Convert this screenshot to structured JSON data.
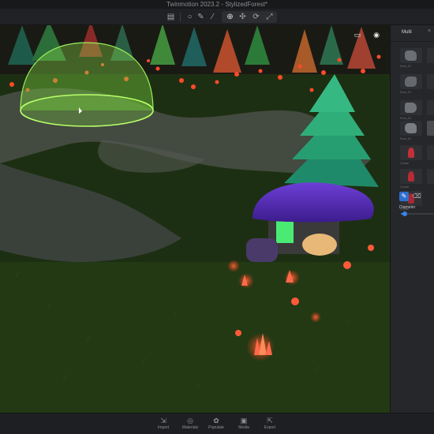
{
  "window": {
    "title": "Twinmotion 2023.2 - StylizedForest*"
  },
  "toolbar": {
    "icons": [
      "layers-icon",
      "circle-select-icon",
      "paint-brush-icon",
      "eyedropper-icon",
      "crosshair-move-icon",
      "move-arrows-icon",
      "rotate-icon",
      "scale-icon"
    ]
  },
  "viewport": {
    "controls": [
      "screen-icon",
      "eye-icon"
    ]
  },
  "panel": {
    "title": "Multi",
    "close_glyph": "×",
    "thumbnails": [
      {
        "caption": "Rock_01",
        "kind": "rock"
      },
      {
        "caption": "Rock_02",
        "kind": "rock"
      },
      {
        "caption": "Rock_03",
        "kind": "rock"
      },
      {
        "caption": "Rock_04",
        "kind": "rock"
      },
      {
        "caption": "Crystal",
        "kind": "crystal"
      },
      {
        "caption": "Crystal",
        "kind": "crystal"
      },
      {
        "caption": "Crystal",
        "kind": "crystal"
      }
    ],
    "tools": [
      "brush-tool-icon",
      "eraser-tool-icon"
    ],
    "diameter_label": "Diameter",
    "diameter_value": 0.12,
    "accent": "#3a82e8"
  },
  "bottombar": {
    "items": [
      {
        "label": "Import",
        "icon": "import-icon",
        "glyph": "⇲"
      },
      {
        "label": "Materials",
        "icon": "materials-icon",
        "glyph": "◎"
      },
      {
        "label": "Populate",
        "icon": "populate-icon",
        "glyph": "✿"
      },
      {
        "label": "Media",
        "icon": "media-icon",
        "glyph": "▣"
      },
      {
        "label": "Export",
        "icon": "export-icon",
        "glyph": "⇱"
      }
    ]
  }
}
